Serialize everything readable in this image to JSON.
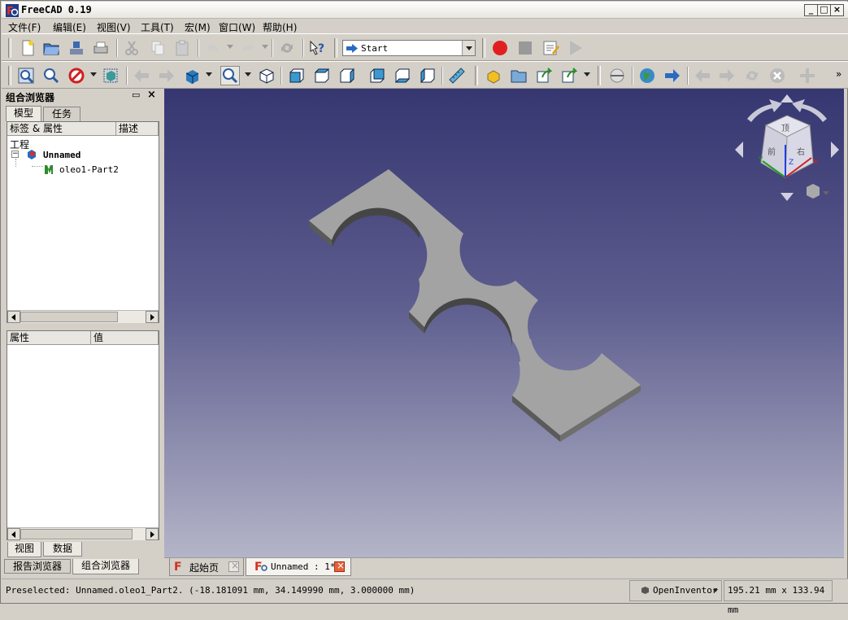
{
  "window": {
    "title": "FreeCAD 0.19",
    "minimize": "_",
    "maximize": "□",
    "close": "×"
  },
  "menu": [
    "文件(F)",
    "编辑(E)",
    "视图(V)",
    "工具(T)",
    "宏(M)",
    "窗口(W)",
    "帮助(H)"
  ],
  "toolbar": {
    "workbench": "Start"
  },
  "combo_view": {
    "title": "组合浏览器",
    "tabs": [
      "模型",
      "任务"
    ],
    "tree_headers": [
      "标签 & 属性",
      "描述"
    ],
    "tree_root": "工程",
    "document": "Unnamed",
    "object": "oleo1-Part2",
    "prop_headers": [
      "属性",
      "值"
    ],
    "bottom_tabs": [
      "视图",
      "数据"
    ]
  },
  "panel_tabs": [
    "报告浏览器",
    "组合浏览器"
  ],
  "doc_tabs": [
    "起始页",
    "Unnamed : 1*"
  ],
  "navcube": {
    "face_top": "顶",
    "face_front": "前",
    "face_right": "右",
    "axis_x": "X",
    "axis_y": "Y",
    "axis_z": "Z"
  },
  "status": {
    "message": "Preselected: Unnamed.oleo1_Part2. (-18.181091 mm, 34.149990 mm, 3.000000 mm)",
    "nav_style": "OpenInventor",
    "dimensions": "195.21 mm x 133.94 mm"
  },
  "colors": {
    "record": "#e02020",
    "viewport_top": "#363671",
    "viewport_bottom": "#b4b4c8",
    "part": "#a3a3a3"
  }
}
